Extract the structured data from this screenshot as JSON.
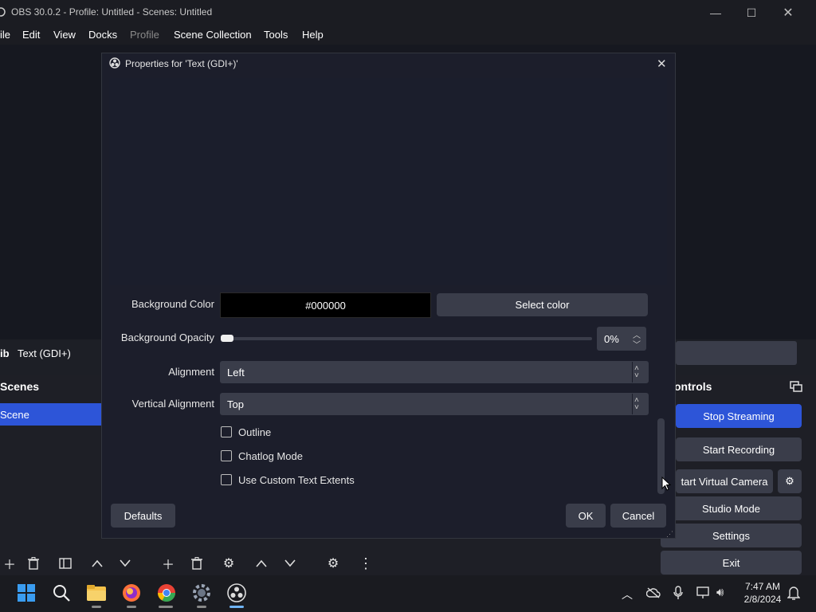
{
  "window": {
    "title": "OBS 30.0.2 - Profile: Untitled - Scenes: Untitled",
    "min": "—",
    "max": "☐",
    "close": "✕"
  },
  "menu": [
    "ile",
    "Edit",
    "View",
    "Docks",
    "Profile",
    "Scene Collection",
    "Tools",
    "Help"
  ],
  "source_bar": {
    "prefix": "ib",
    "name": "Text (GDI+)"
  },
  "scenes": {
    "title": "Scenes",
    "items": [
      "Scene"
    ]
  },
  "controls": {
    "title": "ontrols",
    "stop_streaming": "Stop Streaming",
    "start_recording": "Start Recording",
    "virtual_camera": "tart Virtual Camera",
    "studio_mode": "Studio Mode",
    "settings": "Settings",
    "exit": "Exit"
  },
  "dialog": {
    "title": "Properties for 'Text (GDI+)'",
    "close": "✕",
    "background_color_label": "Background Color",
    "background_color_value": "#000000",
    "select_color": "Select color",
    "background_opacity_label": "Background Opacity",
    "background_opacity_value": "0%",
    "background_opacity_fraction": 0,
    "alignment_label": "Alignment",
    "alignment_value": "Left",
    "vertical_alignment_label": "Vertical Alignment",
    "vertical_alignment_value": "Top",
    "checkboxes": [
      "Outline",
      "Chatlog Mode",
      "Use Custom Text Extents"
    ],
    "defaults": "Defaults",
    "ok": "OK",
    "cancel": "Cancel"
  },
  "taskbar": {
    "time": "7:47 AM",
    "date": "2/8/2024"
  },
  "colors": {
    "accent": "#2d55d8",
    "button": "#3a3d4a",
    "dialog": "#1c1e2b"
  }
}
